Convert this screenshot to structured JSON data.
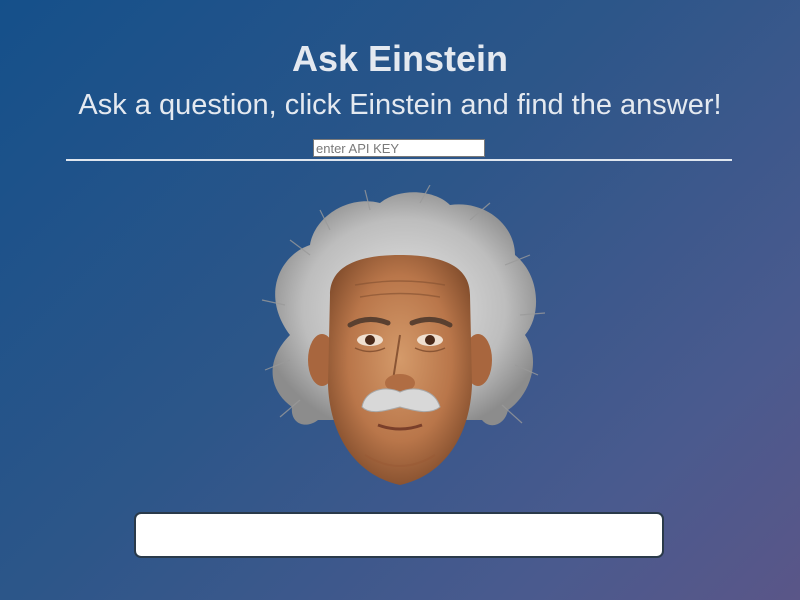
{
  "header": {
    "title": "Ask Einstein",
    "subtitle": "Ask a question, click Einstein and find the answer!"
  },
  "api_key": {
    "placeholder": "enter API KEY",
    "value": ""
  },
  "einstein": {
    "icon": "einstein-head-icon"
  },
  "answer": {
    "value": ""
  },
  "colors": {
    "background_start": "#15508a",
    "background_end": "#5a5688",
    "text": "#e4e9f0"
  }
}
